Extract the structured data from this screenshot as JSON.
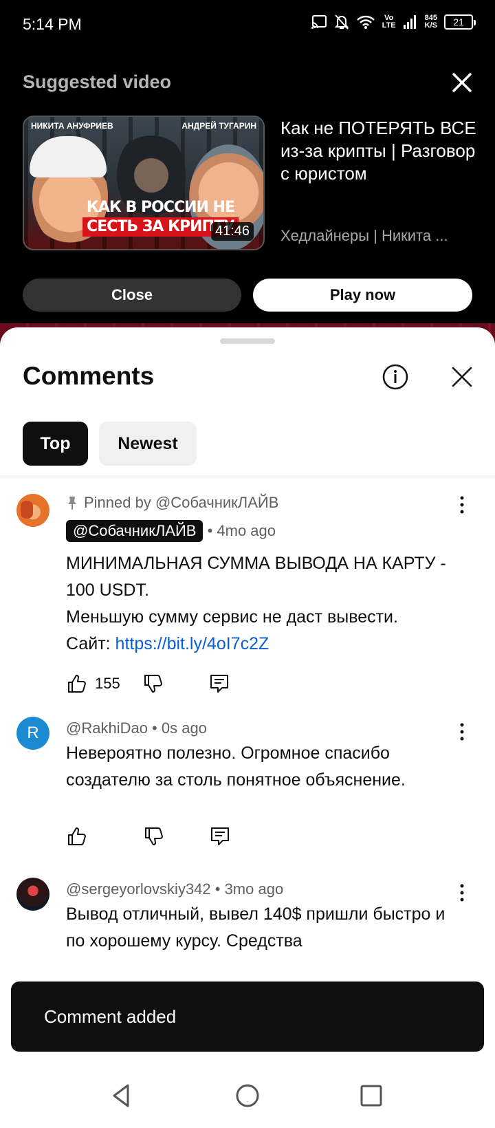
{
  "status_bar": {
    "time": "5:14 PM",
    "net_speed_value": "845",
    "net_speed_unit": "K/S",
    "volte_top": "Vo",
    "volte_bottom": "LTE",
    "battery": "21",
    "icons": [
      "cast-icon",
      "bell-off-icon",
      "wifi-icon",
      "volte-icon",
      "signal-icon",
      "battery-icon"
    ]
  },
  "suggested": {
    "heading": "Suggested video",
    "thumbnail": {
      "left_name": "НИКИТА АНУФРИЕВ",
      "right_name": "АНДРЕЙ ТУГАРИН",
      "caption_line1": "КАК В РОССИИ НЕ",
      "caption_line2": "СЕСТЬ ЗА КРИПТУ",
      "duration": "41:46"
    },
    "video_title": "Как не ПОТЕРЯТЬ ВСЕ из-за крипты | Разговор с юристом",
    "channel": "Хедлайнеры | Никита ...",
    "close_label": "Close",
    "play_label": "Play now"
  },
  "comments_panel": {
    "title": "Comments",
    "chips": [
      {
        "label": "Top",
        "selected": true
      },
      {
        "label": "Newest",
        "selected": false
      }
    ],
    "comments": [
      {
        "pinned_text": "Pinned by @СобачникЛАЙВ",
        "author": "@СобачникЛАЙВ",
        "time": "• 4mo ago",
        "body_lines": [
          "МИНИМАЛЬНАЯ СУММА ВЫВОДА НА КАРТУ - 100 USDT.",
          "Меньшую сумму сервис не даст вывести."
        ],
        "link_prefix": "Сайт: ",
        "link_text": "https://bit.ly/4oI7c2Z",
        "likes": "155"
      },
      {
        "author_meta": "@RakhiDao • 0s ago",
        "avatar_letter": "R",
        "body": "Невероятно полезно. Огромное спасибо создателю за столь понятное объяснение."
      },
      {
        "author_meta": "@sergeyorlovskiy342 • 3mo ago",
        "body": "Вывод отличный, вывел 140$ пришли быстро и по хорошему курсу. Средства"
      }
    ]
  },
  "toast": {
    "message": "Comment added"
  },
  "colors": {
    "link": "#065fd4",
    "accent_dark": "#0f0f0f",
    "avatar_r": "#1c8bd4"
  }
}
